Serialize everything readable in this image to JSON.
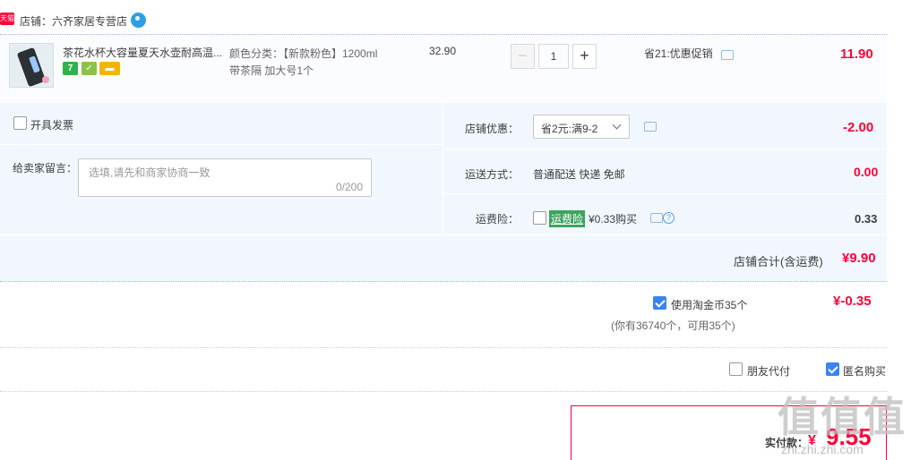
{
  "shop": {
    "badge": "天猫",
    "name": "店铺：六齐家居专营店"
  },
  "item": {
    "title": "茶花水杯大容量夏天水壶耐高温...",
    "tag1": "7",
    "sku_color": "颜色分类：【新款粉色】1200ml",
    "sku_extra": "带茶隔 加大号1个",
    "unit_price": "32.90",
    "quantity": "1",
    "minus": "−",
    "plus": "+",
    "promo": "省21:优惠促销",
    "total": "11.90"
  },
  "invoice": {
    "label": "开具发票"
  },
  "message": {
    "label": "给卖家留言：",
    "placeholder": "选填,请先和商家协商一致",
    "counter": "0/200"
  },
  "discount": {
    "label": "店铺优惠：",
    "selected": "省2元:满9-2",
    "amount": "-2.00"
  },
  "shipping": {
    "label": "运送方式：",
    "value": "普通配送 快递 免邮",
    "amount": "0.00"
  },
  "insurance": {
    "label": "运费险：",
    "badge": "运费险",
    "desc": "¥0.33购买",
    "help": "?",
    "amount": "0.33"
  },
  "subtotal": {
    "label": "店铺合计(含运费)",
    "value": "¥9.90"
  },
  "coins": {
    "label": "使用淘金币35个",
    "note": "(你有36740个，可用35个)",
    "amount": "¥-0.35"
  },
  "options": {
    "friend_pay": "朋友代付",
    "anonymous": "匿名购买"
  },
  "payment": {
    "label": "实付款：",
    "symbol": "¥",
    "amount": "9.55"
  },
  "watermark": {
    "main": "值值值",
    "sub": "zhi.zhi.zhi.com"
  }
}
